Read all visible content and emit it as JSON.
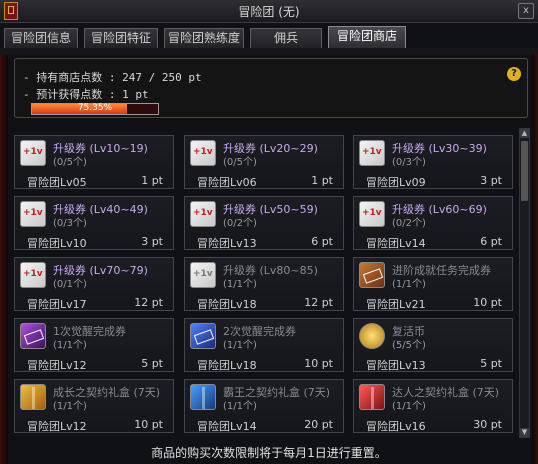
{
  "window": {
    "title": "冒险团 (无)",
    "close_label": "x"
  },
  "tabs": [
    {
      "label": "冒险团信息"
    },
    {
      "label": "冒险团特征"
    },
    {
      "label": "冒险团熟练度"
    },
    {
      "label": "佣兵"
    },
    {
      "label": "冒险团商店"
    }
  ],
  "info": {
    "points_line": "- 持有商店点数 : 247 / 250 pt",
    "expected_line": "- 预计获得点数 :   1 pt",
    "progress_label": "75.35%",
    "progress_value": 75.35,
    "help": "?"
  },
  "items": [
    {
      "name": "升级券 (Lv10~19)",
      "limit": "(0/5个)",
      "level": "冒险团Lv05",
      "price": "1 pt",
      "icon": "level-up-ticket-icon"
    },
    {
      "name": "升级券 (Lv20~29)",
      "limit": "(0/5个)",
      "level": "冒险团Lv06",
      "price": "1 pt",
      "icon": "level-up-ticket-icon"
    },
    {
      "name": "升级券 (Lv30~39)",
      "limit": "(0/3个)",
      "level": "冒险团Lv09",
      "price": "3 pt",
      "icon": "level-up-ticket-icon"
    },
    {
      "name": "升级券 (Lv40~49)",
      "limit": "(0/3个)",
      "level": "冒险团Lv10",
      "price": "3 pt",
      "icon": "level-up-ticket-icon"
    },
    {
      "name": "升级券 (Lv50~59)",
      "limit": "(0/2个)",
      "level": "冒险团Lv13",
      "price": "6 pt",
      "icon": "level-up-ticket-icon"
    },
    {
      "name": "升级券 (Lv60~69)",
      "limit": "(0/2个)",
      "level": "冒险团Lv14",
      "price": "6 pt",
      "icon": "level-up-ticket-icon"
    },
    {
      "name": "升级券 (Lv70~79)",
      "limit": "(0/1个)",
      "level": "冒险团Lv17",
      "price": "12 pt",
      "icon": "level-up-ticket-icon"
    },
    {
      "name": "升级券 (Lv80~85)",
      "limit": "(1/1个)",
      "level": "冒险团Lv18",
      "price": "12 pt",
      "icon": "level-up-ticket-icon"
    },
    {
      "name": "进阶成就任务完成券",
      "limit": "(1/1个)",
      "level": "冒险团Lv21",
      "price": "10 pt",
      "icon": "quest-ticket-icon"
    },
    {
      "name": "1次觉醒完成券",
      "limit": "(1/1个)",
      "level": "冒险团Lv12",
      "price": "5 pt",
      "icon": "awaken-ticket-icon"
    },
    {
      "name": "2次觉醒完成券",
      "limit": "(1/1个)",
      "level": "冒险团Lv18",
      "price": "10 pt",
      "icon": "awaken-ticket-icon"
    },
    {
      "name": "复活币",
      "limit": "(5/5个)",
      "level": "冒险团Lv13",
      "price": "5 pt",
      "icon": "revive-coin-icon"
    },
    {
      "name": "成长之契约礼盒 (7天)",
      "limit": "(1/1个)",
      "level": "冒险团Lv12",
      "price": "10 pt",
      "icon": "gift-box-icon"
    },
    {
      "name": "霸王之契约礼盒 (7天)",
      "limit": "(1/1个)",
      "level": "冒险团Lv14",
      "price": "20 pt",
      "icon": "gift-box-icon"
    },
    {
      "name": "达人之契约礼盒 (7天)",
      "limit": "(1/1个)",
      "level": "冒险团Lv16",
      "price": "30 pt",
      "icon": "gift-box-icon"
    }
  ],
  "notice": "商品的购买次数限制将于每月1日进行重置。",
  "scroll": {
    "up": "▲",
    "down": "▼"
  }
}
